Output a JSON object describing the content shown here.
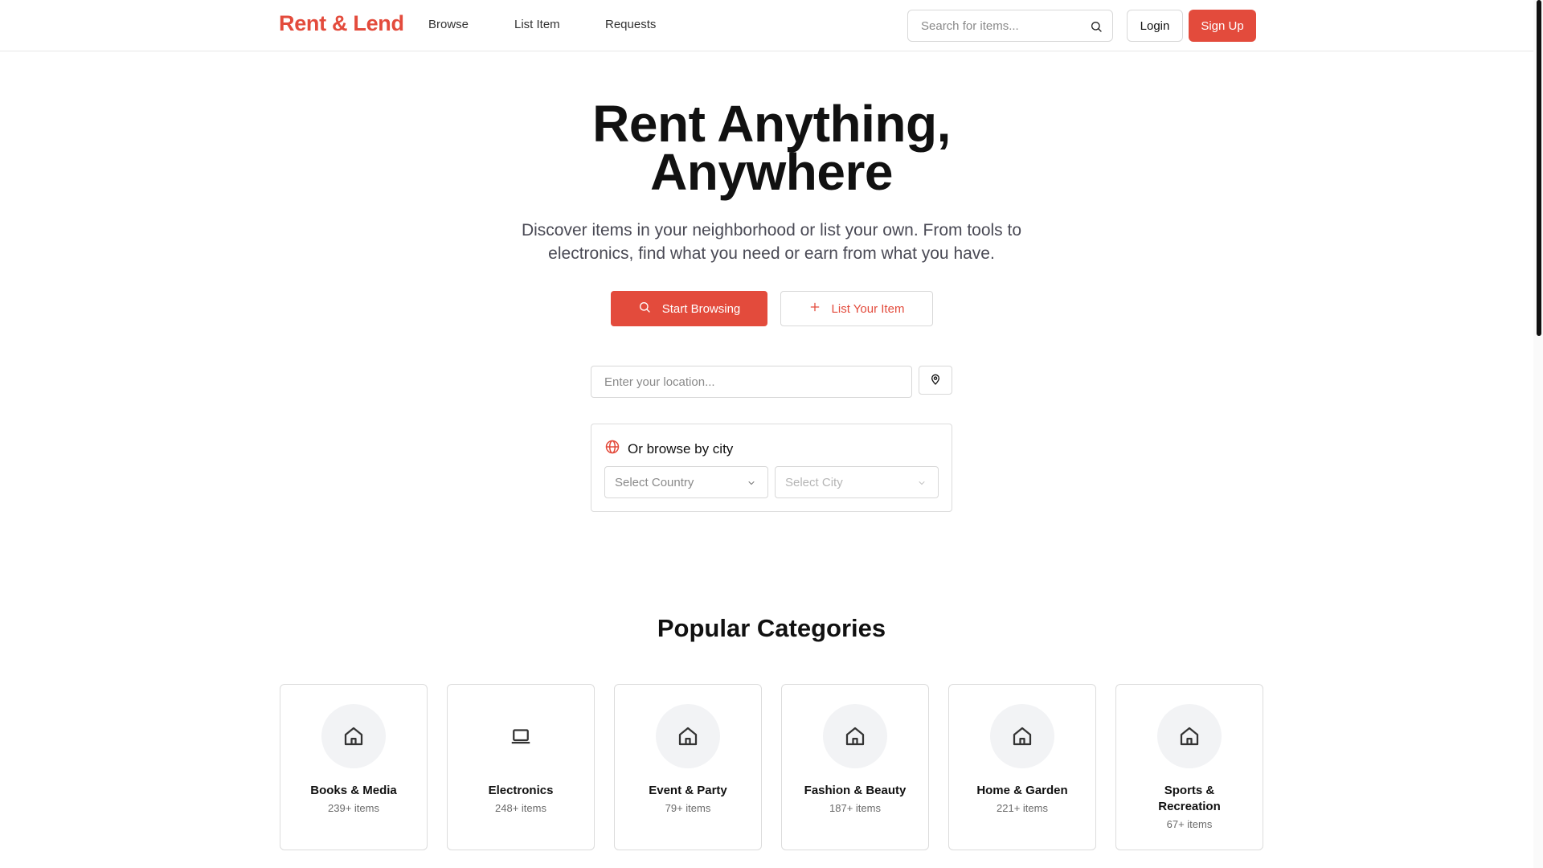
{
  "brand": {
    "name": "Rent & Lend",
    "accent": "#e34b3c"
  },
  "nav": {
    "items": [
      {
        "label": "Browse"
      },
      {
        "label": "List Item"
      },
      {
        "label": "Requests"
      }
    ]
  },
  "search": {
    "placeholder": "Search for items...",
    "value": "",
    "icon": "search-icon"
  },
  "auth": {
    "login_label": "Login",
    "signup_label": "Sign Up"
  },
  "hero": {
    "title_line1": "Rent Anything,",
    "title_line2": "Anywhere",
    "subtitle": "Discover items in your neighborhood or list your own. From tools to electronics, find what you need or earn from what you have.",
    "primary_button": {
      "label": "Start Browsing",
      "icon": "search-icon"
    },
    "secondary_button": {
      "label": "List Your Item",
      "icon": "plus-icon"
    }
  },
  "location": {
    "placeholder": "Enter your location...",
    "value": "",
    "button_icon": "map-pin-icon"
  },
  "city_browse": {
    "title": "Or browse by city",
    "icon": "globe-icon",
    "country_select": {
      "selected": "Select Country",
      "disabled": false
    },
    "city_select": {
      "selected": "Select City",
      "disabled": true
    }
  },
  "categories": {
    "title": "Popular Categories",
    "items": [
      {
        "name": "Books & Media",
        "count": "239+ items",
        "icon": "home-icon"
      },
      {
        "name": "Electronics",
        "count": "248+ items",
        "icon": "laptop-icon"
      },
      {
        "name": "Event & Party",
        "count": "79+ items",
        "icon": "home-icon"
      },
      {
        "name": "Fashion & Beauty",
        "count": "187+ items",
        "icon": "home-icon"
      },
      {
        "name": "Home & Garden",
        "count": "221+ items",
        "icon": "home-icon"
      },
      {
        "name": "Sports & Recreation",
        "count": "67+ items",
        "icon": "home-icon"
      }
    ]
  }
}
